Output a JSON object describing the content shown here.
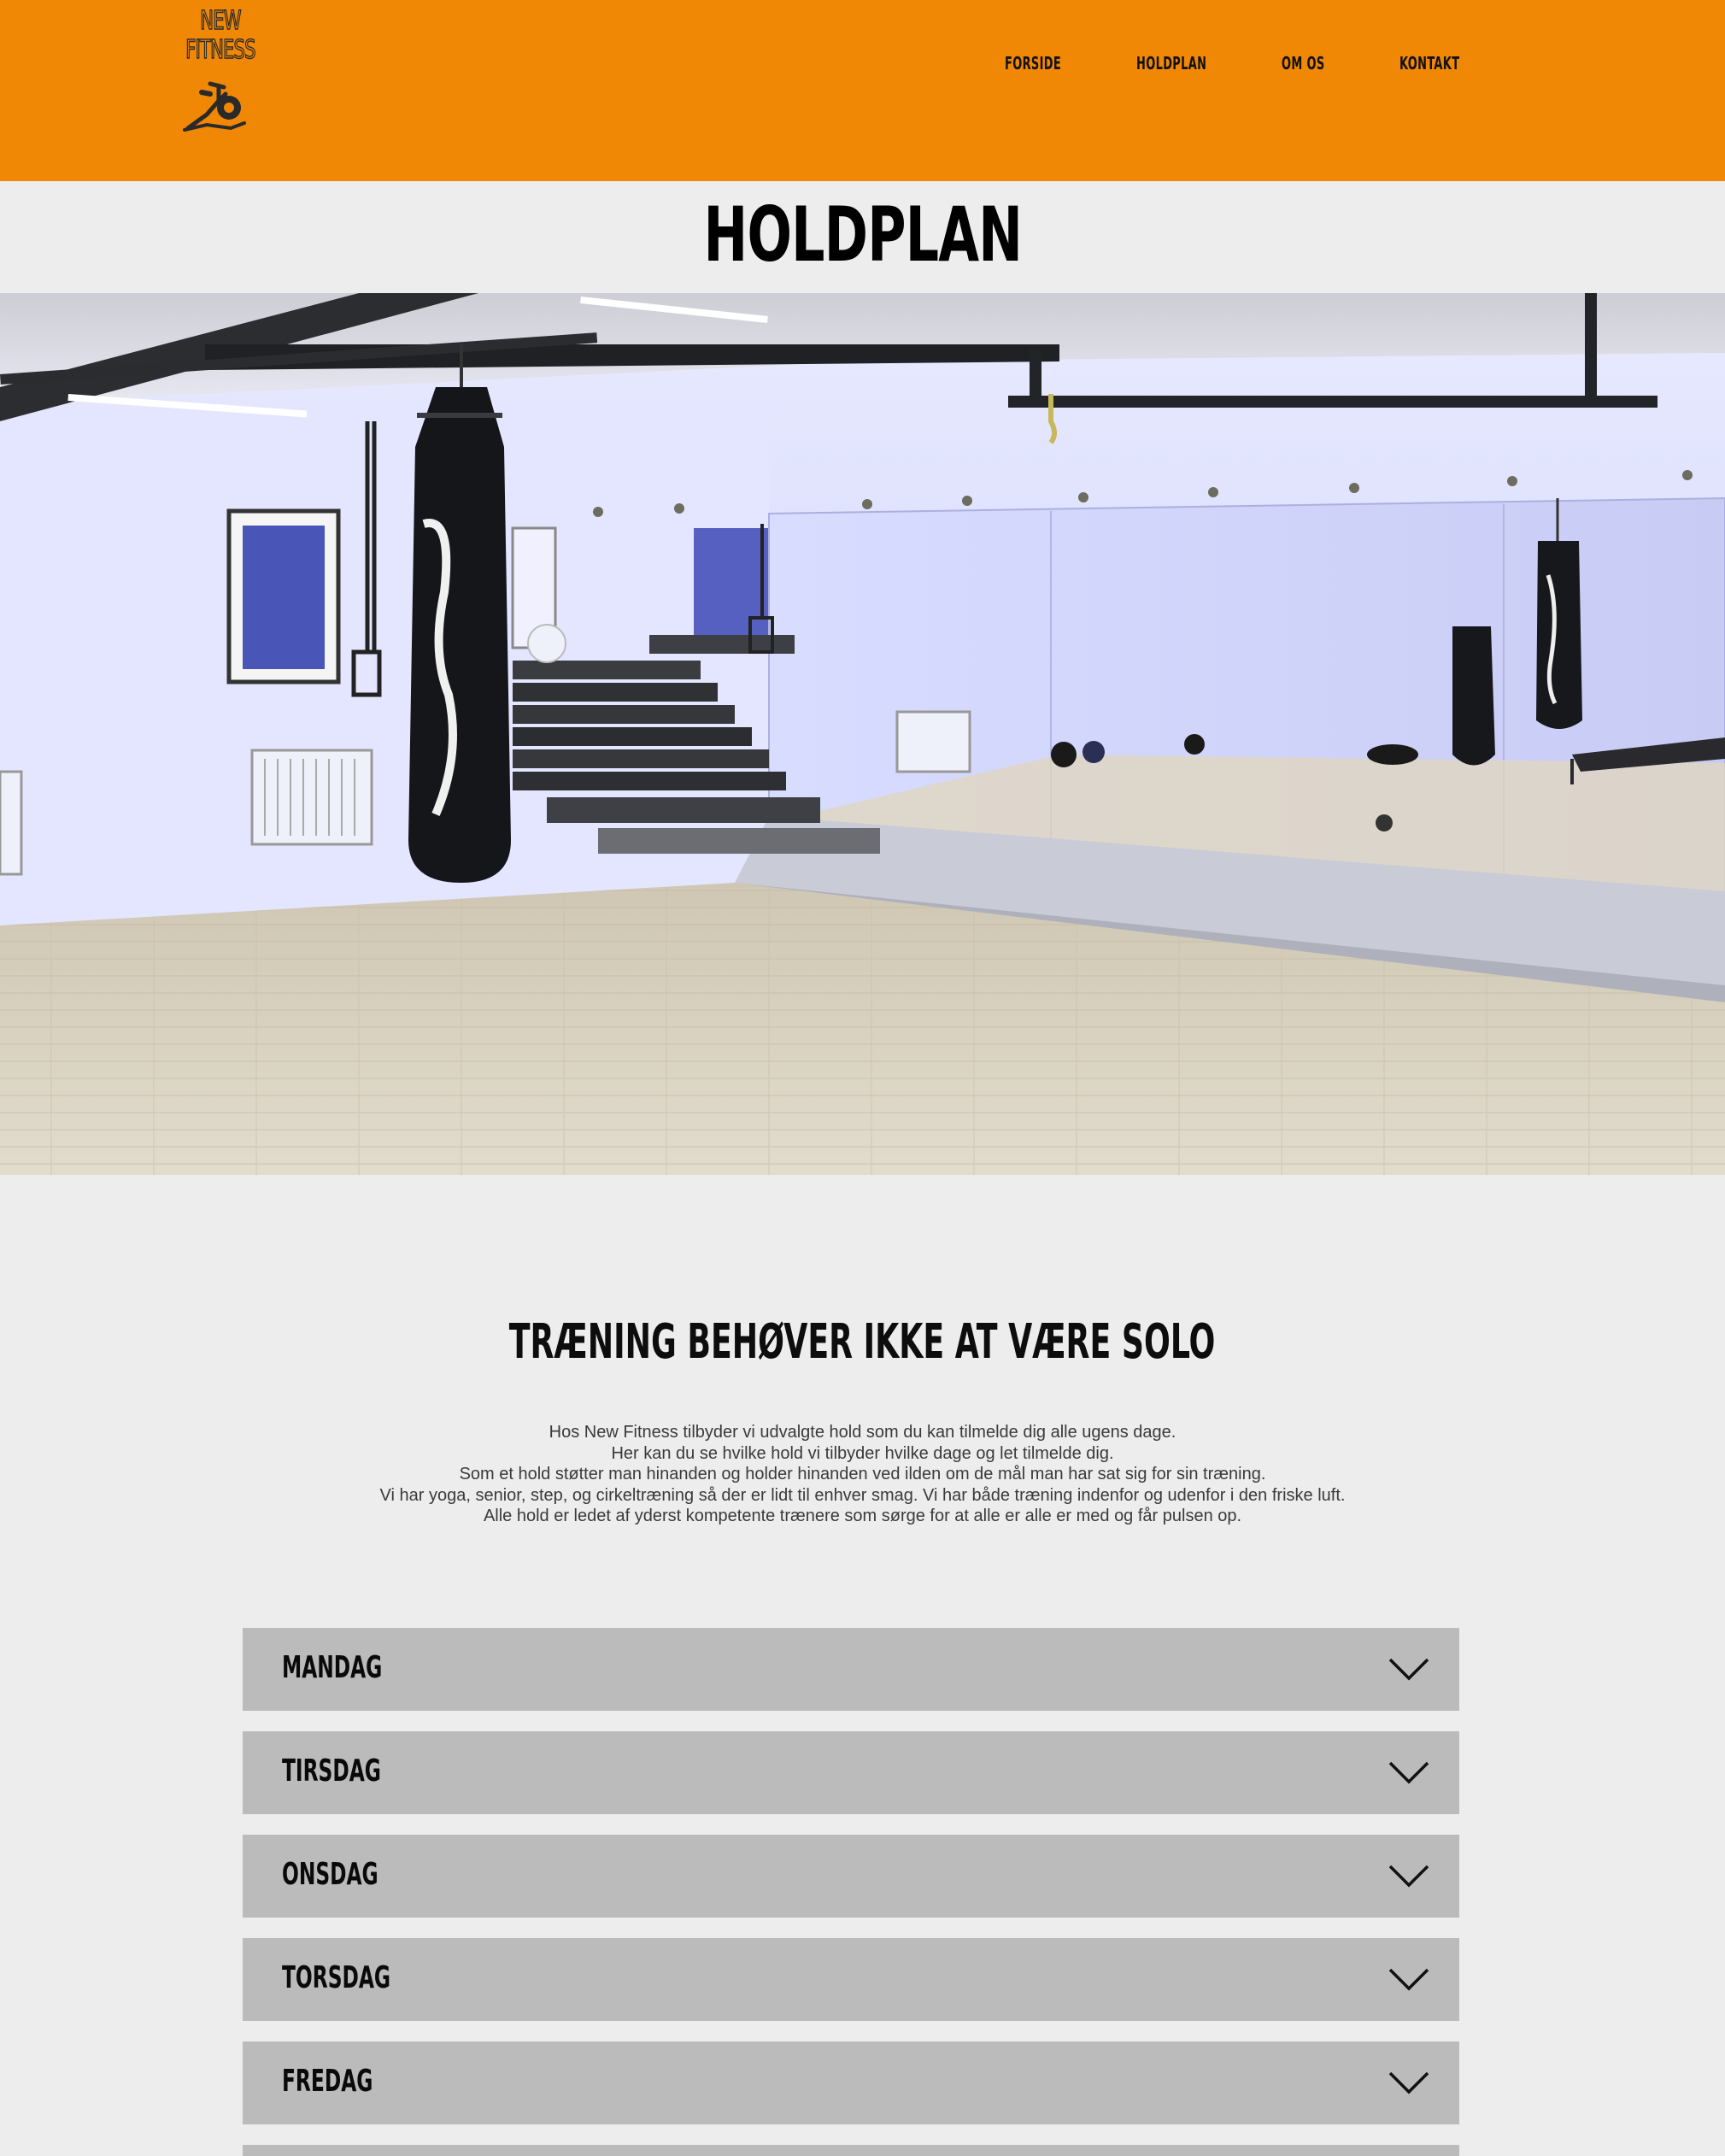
{
  "colors": {
    "header_bg": "#f08705",
    "page_bg": "#ededed",
    "accordion_bg": "#bbbbbb",
    "text_dark": "#0a0a0a"
  },
  "logo": {
    "line1": "NEW",
    "line2": "FITNESS",
    "icon": "spinning-bike-icon"
  },
  "nav": {
    "items": [
      {
        "label": "FORSIDE"
      },
      {
        "label": "HOLDPLAN"
      },
      {
        "label": "OM OS"
      },
      {
        "label": "KONTAKT"
      }
    ]
  },
  "page": {
    "title": "HOLDPLAN"
  },
  "intro": {
    "heading": "TRÆNING BEHØVER IKKE AT VÆRE SOLO",
    "lines": [
      "Hos New Fitness tilbyder vi udvalgte hold som du kan tilmelde dig alle ugens dage.",
      "Her kan du se hvilke hold vi tilbyder hvilke dage og let tilmelde dig.",
      "Som et hold støtter man hinanden og holder hinanden ved ilden om de mål man har sat sig for sin træning.",
      "Vi har yoga, senior, step, og cirkeltræning så der er lidt til enhver smag. Vi har både træning indenfor og udenfor i den friske luft.",
      "Alle hold er ledet af yderst kompetente trænere som sørge for at alle er alle er med og får pulsen op."
    ]
  },
  "schedule": {
    "days": [
      {
        "label": "MANDAG",
        "icon": "chevron-down-icon"
      },
      {
        "label": "TIRSDAG",
        "icon": "chevron-down-icon"
      },
      {
        "label": "ONSDAG",
        "icon": "chevron-down-icon"
      },
      {
        "label": "TORSDAG",
        "icon": "chevron-down-icon"
      },
      {
        "label": "FREDAG",
        "icon": "chevron-down-icon"
      }
    ]
  }
}
